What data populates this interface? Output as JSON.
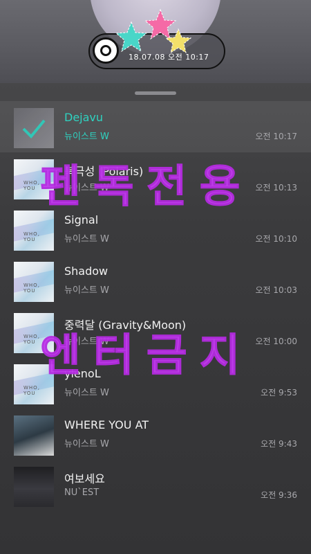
{
  "player": {
    "timestamp": "18.07.08 오전 10:17"
  },
  "colors": {
    "accent": "#2fd3c1",
    "watermark": "#c33cf0"
  },
  "songs": [
    {
      "title": "Dejavu",
      "artist": "뉴이스트 W",
      "time": "오전 10:17",
      "selected": true
    },
    {
      "title": "북극성 (Polaris)",
      "artist": "뉴이스트 W",
      "time": "오전 10:13"
    },
    {
      "title": "Signal",
      "artist": "뉴이스트 W",
      "time": "오전 10:10"
    },
    {
      "title": "Shadow",
      "artist": "뉴이스트 W",
      "time": "오전 10:03"
    },
    {
      "title": "중력달 (Gravity&Moon)",
      "artist": "뉴이스트 W",
      "time": "오전 10:00"
    },
    {
      "title": "ylenoL",
      "artist": "뉴이스트 W",
      "time": "오전 9:53"
    },
    {
      "title": "WHERE YOU AT",
      "artist": "뉴이스트 W",
      "time": "오전 9:43"
    },
    {
      "title": "여보세요",
      "artist": "NU`EST",
      "time": "오전 9:36"
    }
  ],
  "album_text": "WHO, YOU",
  "watermarks": {
    "line1": "펜독전용",
    "line2": "엔터금지"
  },
  "icons": [
    "disc-icon",
    "star-icon",
    "check-icon"
  ]
}
